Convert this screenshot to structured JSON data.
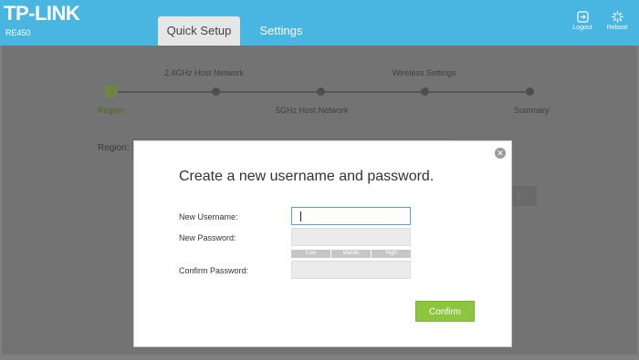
{
  "header": {
    "logo": "TP-LINK",
    "model": "RE450",
    "tabs": [
      {
        "label": "Quick Setup",
        "active": true
      },
      {
        "label": "Settings",
        "active": false
      }
    ],
    "logout_label": "Logout",
    "reboot_label": "Reboot",
    "logout_icon": "logout-icon",
    "reboot_icon": "reboot-icon"
  },
  "progress": {
    "top_labels": [
      "2.4GHz Host Network",
      "Wireless Settings"
    ],
    "bottom_labels": [
      "Region",
      "5GHz Host Network",
      "Summary"
    ],
    "current_step": "Region"
  },
  "background_form": {
    "region_label": "Region:",
    "next_label": "t"
  },
  "modal": {
    "title": "Create a new username and password.",
    "close_icon": "close-icon",
    "new_username_label": "New Username:",
    "new_password_label": "New Password:",
    "confirm_password_label": "Confirm Password:",
    "strength": [
      "Low",
      "Middle",
      "High"
    ],
    "confirm_label": "Confirm"
  },
  "colors": {
    "header": "#49b5e1",
    "confirm_button": "#8cc63f",
    "active_step": "#6a8a25"
  }
}
